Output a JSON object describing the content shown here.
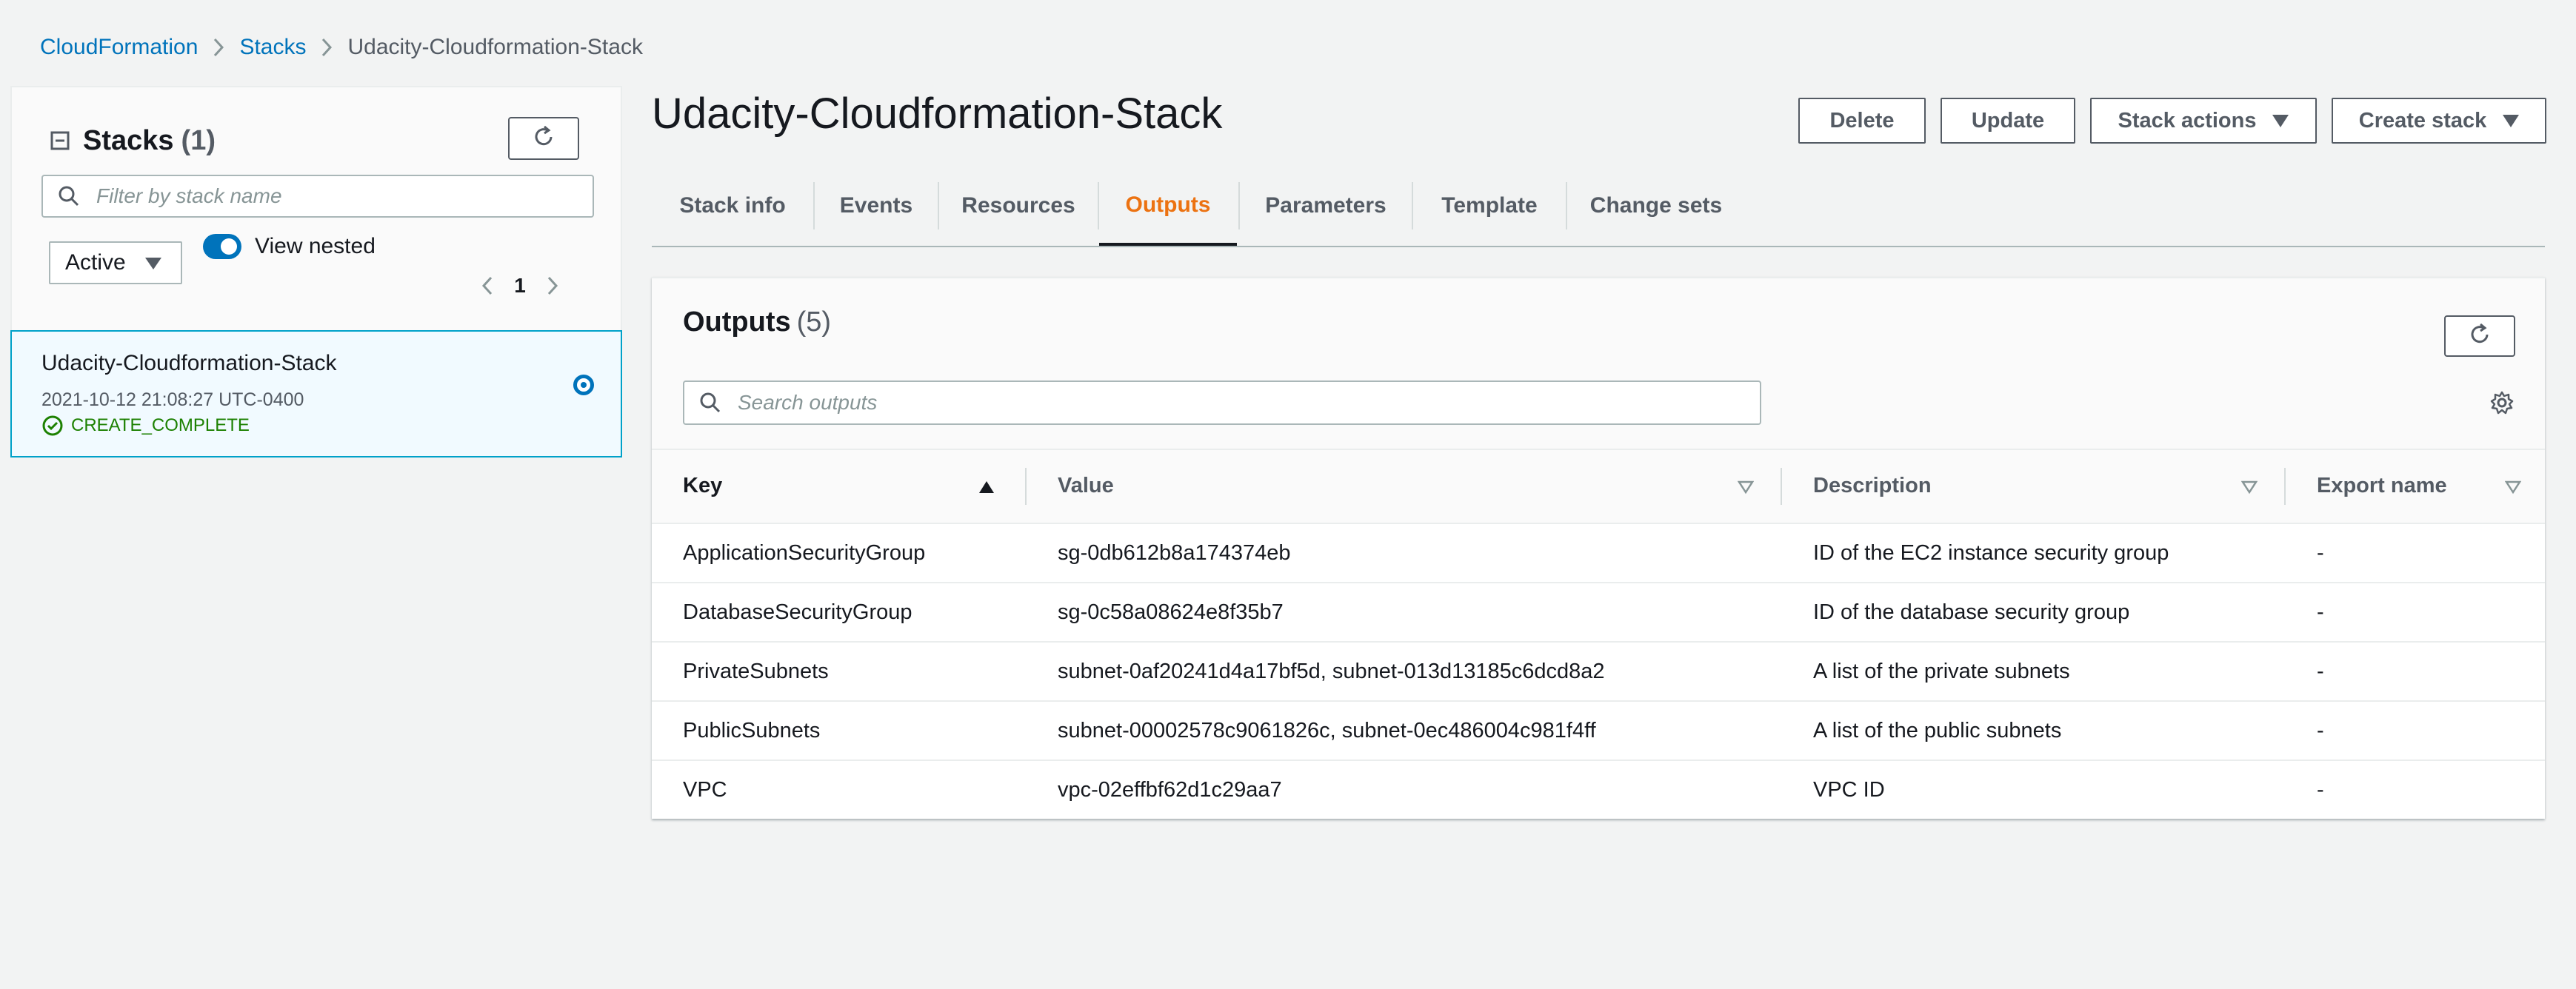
{
  "breadcrumb": {
    "items": [
      "CloudFormation",
      "Stacks"
    ],
    "current": "Udacity-Cloudformation-Stack"
  },
  "sidebar": {
    "title": "Stacks",
    "count": "(1)",
    "filter_placeholder": "Filter by stack name",
    "status_filter": "Active",
    "view_nested_label": "View nested",
    "view_nested_enabled": true,
    "page": "1",
    "stacks": [
      {
        "name": "Udacity-Cloudformation-Stack",
        "date": "2021-10-12 21:08:27 UTC-0400",
        "status": "CREATE_COMPLETE",
        "selected": true
      }
    ]
  },
  "main": {
    "title": "Udacity-Cloudformation-Stack",
    "buttons": {
      "delete": "Delete",
      "update": "Update",
      "stack_actions": "Stack actions",
      "create_stack": "Create stack"
    },
    "tabs": [
      "Stack info",
      "Events",
      "Resources",
      "Outputs",
      "Parameters",
      "Template",
      "Change sets"
    ],
    "active_tab": "Outputs"
  },
  "outputs": {
    "title": "Outputs",
    "count": "(5)",
    "search_placeholder": "Search outputs",
    "columns": [
      "Key",
      "Value",
      "Description",
      "Export name"
    ],
    "rows": [
      [
        "ApplicationSecurityGroup",
        "sg-0db612b8a174374eb",
        "ID of the EC2 instance security group",
        "-"
      ],
      [
        "DatabaseSecurityGroup",
        "sg-0c58a08624e8f35b7",
        "ID of the database security group",
        "-"
      ],
      [
        "PrivateSubnets",
        "subnet-0af20241d4a17bf5d, subnet-013d13185c6dcd8a2",
        "A list of the private subnets",
        "-"
      ],
      [
        "PublicSubnets",
        "subnet-00002578c9061826c, subnet-0ec486004c981f4ff",
        "A list of the public subnets",
        "-"
      ],
      [
        "VPC",
        "vpc-02effbf62d1c29aa7",
        "VPC ID",
        "-"
      ]
    ]
  },
  "colors": {
    "link": "#0073bb",
    "active_tab": "#ec7211",
    "success": "#1d8102",
    "selected_bg": "#f1faff",
    "selected_border": "#00a1c9"
  }
}
